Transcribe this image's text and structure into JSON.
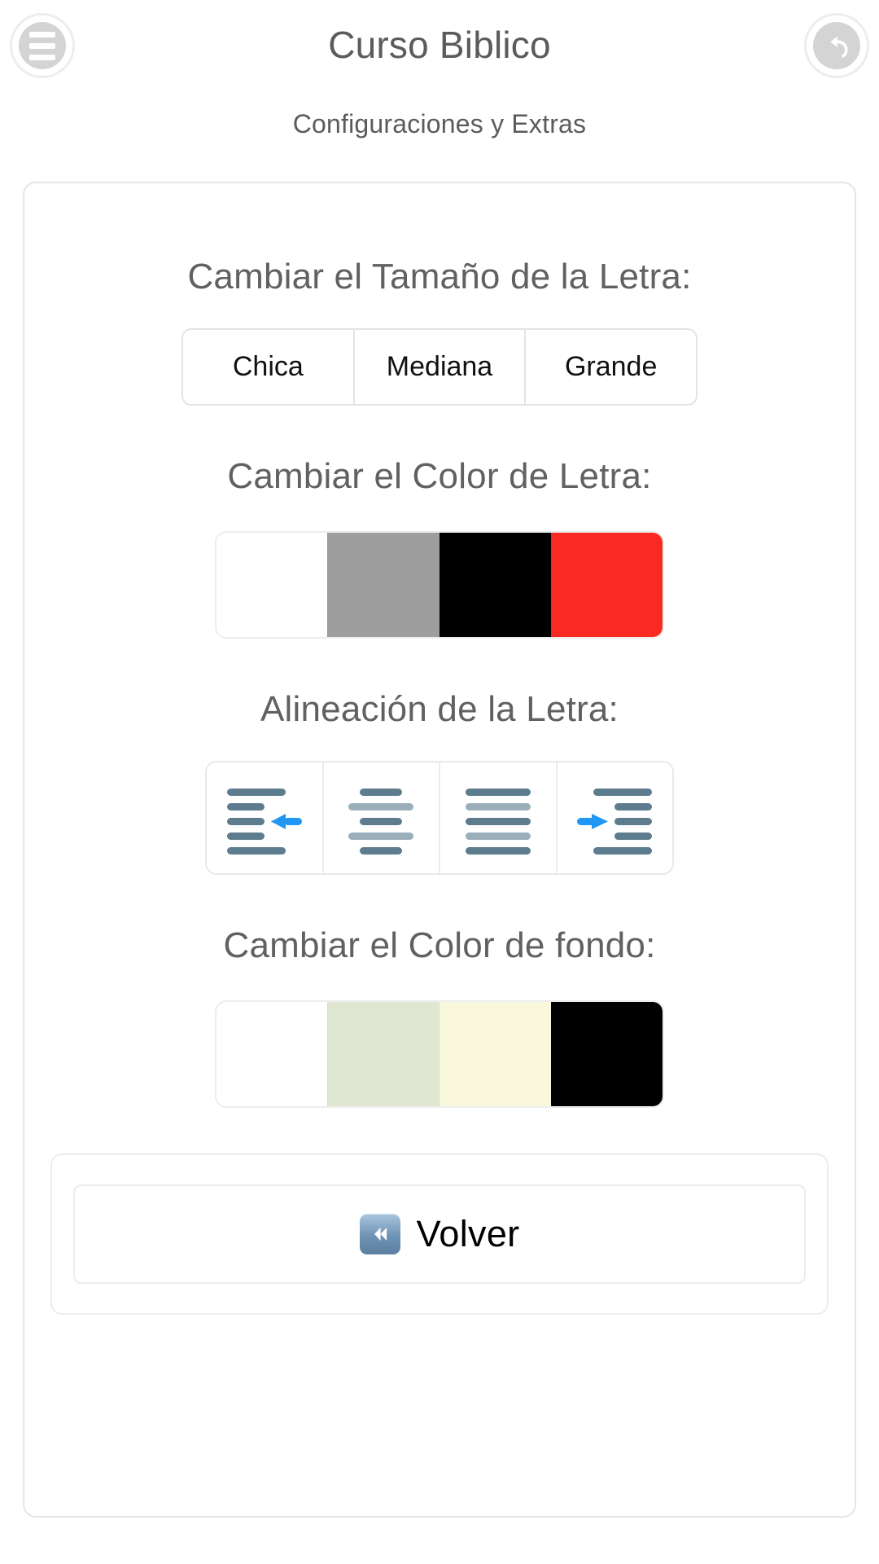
{
  "header": {
    "title": "Curso Biblico",
    "menu_icon": "hamburger-menu-icon",
    "back_icon": "undo-back-arrow-icon"
  },
  "subtitle": "Configuraciones y Extras",
  "sections": {
    "font_size": {
      "title": "Cambiar el Tamaño de la Letra:",
      "options": [
        "Chica",
        "Mediana",
        "Grande"
      ]
    },
    "font_color": {
      "title": "Cambiar el Color de Letra:",
      "swatches": [
        {
          "name": "white",
          "hex": "#FFFFFF"
        },
        {
          "name": "gray",
          "hex": "#9E9E9E"
        },
        {
          "name": "black",
          "hex": "#000000"
        },
        {
          "name": "red",
          "hex": "#F82A22"
        }
      ]
    },
    "alignment": {
      "title": "Alineación de la Letra:",
      "options": [
        {
          "name": "align-left-icon",
          "label": "Izquierda"
        },
        {
          "name": "align-center-icon",
          "label": "Centro"
        },
        {
          "name": "align-justify-icon",
          "label": "Justificado"
        },
        {
          "name": "align-right-icon",
          "label": "Derecha"
        }
      ],
      "accent_color": "#2196F3",
      "line_color_dark": "#5D7C8E",
      "line_color_light": "#9BAFBB"
    },
    "background_color": {
      "title": "Cambiar el Color de fondo:",
      "swatches": [
        {
          "name": "white",
          "hex": "#FFFFFF"
        },
        {
          "name": "pale-green",
          "hex": "#DFE7D3"
        },
        {
          "name": "pale-yellow",
          "hex": "#FAF8DC"
        },
        {
          "name": "black",
          "hex": "#000000"
        }
      ]
    }
  },
  "footer": {
    "back_label": "Volver",
    "back_icon": "rewind-double-left-icon"
  }
}
